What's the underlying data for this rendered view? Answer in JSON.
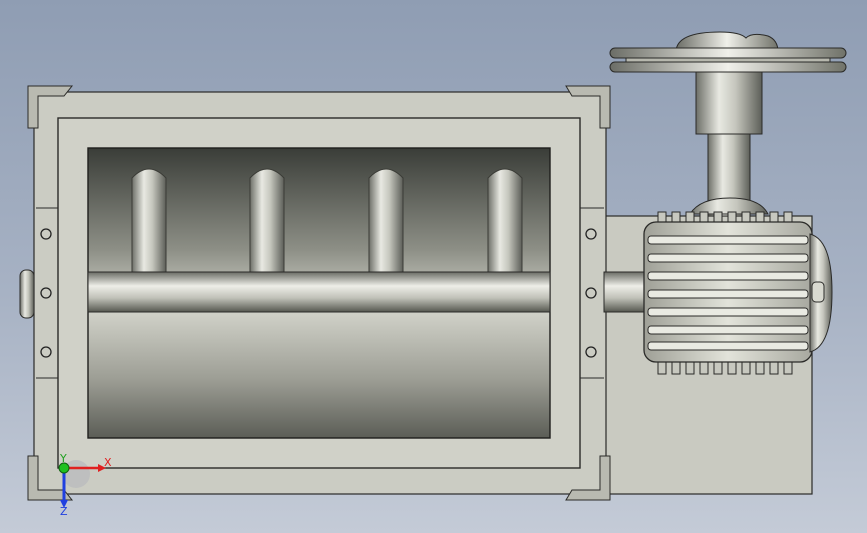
{
  "viewport": {
    "background_top": "#8f9db3",
    "background_bottom": "#c4cbd7"
  },
  "model": {
    "description_icons": [
      "housing",
      "mixing-chamber",
      "paddle",
      "shaft",
      "gear-motor",
      "pulley",
      "bolt"
    ],
    "paddle_count": 4,
    "bolt_count_per_side": 3
  },
  "triad": {
    "x_label": "X",
    "y_label": "Y",
    "z_label": "Z",
    "x_color": "#e02020",
    "y_color": "#20c020",
    "z_color": "#2040e0"
  }
}
